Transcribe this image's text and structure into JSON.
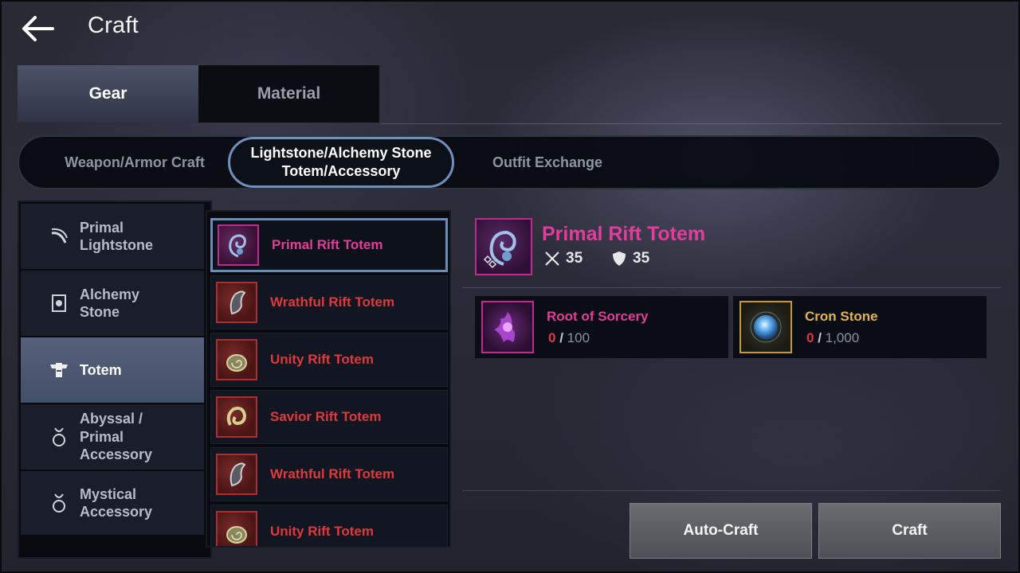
{
  "header": {
    "back_icon": "back-arrow-icon",
    "title": "Craft"
  },
  "main_tabs": [
    {
      "label": "Gear",
      "active": true
    },
    {
      "label": "Material",
      "active": false
    }
  ],
  "sub_tabs": [
    {
      "label": "Weapon/Armor Craft",
      "active": false
    },
    {
      "label_line1": "Lightstone/Alchemy Stone",
      "label_line2": "Totem/Accessory",
      "active": true
    },
    {
      "label": "Outfit Exchange",
      "active": false
    }
  ],
  "categories": [
    {
      "line1": "Primal",
      "line2": "Lightstone",
      "icon": "lightstone-icon",
      "active": false
    },
    {
      "line1": "Alchemy",
      "line2": "Stone",
      "icon": "alchemy-stone-icon",
      "active": false
    },
    {
      "label": "Totem",
      "icon": "totem-icon",
      "active": true
    },
    {
      "line1": "Abyssal /",
      "line2": "Primal",
      "line3": "Accessory",
      "icon": "necklace-icon",
      "active": false
    },
    {
      "line1": "Mystical",
      "line2": "Accessory",
      "icon": "necklace-icon",
      "active": false
    }
  ],
  "items": [
    {
      "name": "Primal Rift Totem",
      "selected": true
    },
    {
      "name": "Wrathful Rift Totem",
      "selected": false
    },
    {
      "name": "Unity Rift Totem",
      "selected": false
    },
    {
      "name": "Savior Rift Totem",
      "selected": false
    },
    {
      "name": "Wrathful Rift Totem",
      "selected": false
    },
    {
      "name": "Unity Rift Totem",
      "selected": false
    }
  ],
  "detail": {
    "name": "Primal Rift Totem",
    "attack_icon": "crossed-swords-icon",
    "attack": "35",
    "defense_icon": "shield-icon",
    "defense": "35"
  },
  "materials": [
    {
      "name": "Root of Sorcery",
      "have": "0",
      "separator": "/",
      "need": "100",
      "name_color": "#e43c9a"
    },
    {
      "name": "Cron Stone",
      "have": "0",
      "separator": "/",
      "need": "1,000",
      "name_color": "#e8b24a"
    }
  ],
  "buttons": {
    "auto_craft": "Auto-Craft",
    "craft": "Craft"
  },
  "colors": {
    "legendary_magenta": "#e43c9a",
    "item_red": "#e0393c",
    "accent_blue": "#6f8fbc"
  }
}
